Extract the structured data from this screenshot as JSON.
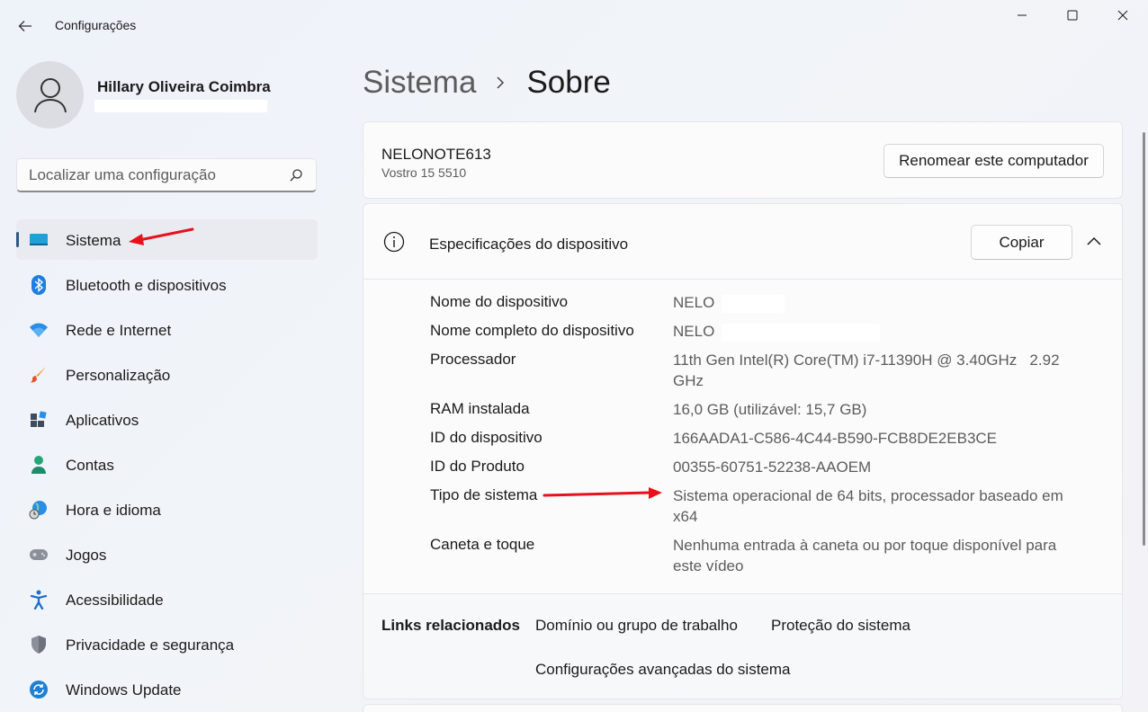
{
  "window": {
    "title": "Configurações"
  },
  "user": {
    "name": "Hillary Oliveira Coimbra"
  },
  "search": {
    "placeholder": "Localizar uma configuração"
  },
  "sidebar": {
    "items": [
      {
        "label": "Sistema",
        "icon": "monitor-icon",
        "active": true
      },
      {
        "label": "Bluetooth e dispositivos",
        "icon": "bluetooth-icon"
      },
      {
        "label": "Rede e Internet",
        "icon": "wifi-icon"
      },
      {
        "label": "Personalização",
        "icon": "brush-icon"
      },
      {
        "label": "Aplicativos",
        "icon": "apps-icon"
      },
      {
        "label": "Contas",
        "icon": "person-icon"
      },
      {
        "label": "Hora e idioma",
        "icon": "globe-clock-icon"
      },
      {
        "label": "Jogos",
        "icon": "gamepad-icon"
      },
      {
        "label": "Acessibilidade",
        "icon": "accessibility-icon"
      },
      {
        "label": "Privacidade e segurança",
        "icon": "shield-icon"
      },
      {
        "label": "Windows Update",
        "icon": "update-icon"
      }
    ]
  },
  "breadcrumb": {
    "parent": "Sistema",
    "current": "Sobre"
  },
  "device": {
    "name": "NELONOTE613",
    "model": "Vostro 15 5510",
    "rename_label": "Renomear este computador"
  },
  "specs": {
    "title": "Especificações do dispositivo",
    "copy_label": "Copiar",
    "rows": [
      {
        "label": "Nome do dispositivo",
        "value": "NELO"
      },
      {
        "label": "Nome completo do dispositivo",
        "value": "NELO"
      },
      {
        "label": "Processador",
        "value": "11th Gen Intel(R) Core(TM) i7-11390H @ 3.40GHz   2.92 GHz"
      },
      {
        "label": "RAM instalada",
        "value": "16,0 GB (utilizável: 15,7 GB)"
      },
      {
        "label": "ID do dispositivo",
        "value": "166AADA1-C586-4C44-B590-FCB8DE2EB3CE"
      },
      {
        "label": "ID do Produto",
        "value": "00355-60751-52238-AAOEM"
      },
      {
        "label": "Tipo de sistema",
        "value": "Sistema operacional de 64 bits, processador baseado em x64"
      },
      {
        "label": "Caneta e toque",
        "value": "Nenhuma entrada à caneta ou por toque disponível para este vídeo"
      }
    ]
  },
  "related_links": {
    "title": "Links relacionados",
    "links": [
      "Domínio ou grupo de trabalho",
      "Proteção do sistema",
      "Configurações avançadas do sistema"
    ]
  },
  "colors": {
    "accent": "#2c5a83",
    "annotation_arrow": "#e8101b"
  }
}
